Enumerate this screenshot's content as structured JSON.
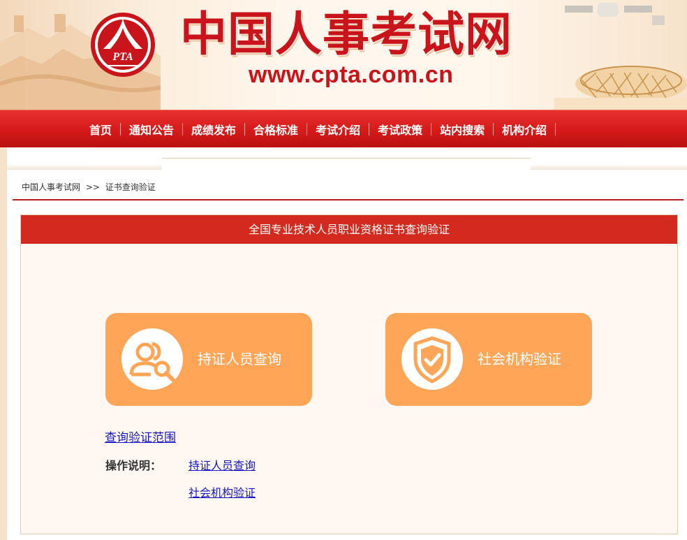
{
  "header": {
    "site_title": "中国人事考试网",
    "site_url": "www.cpta.com.cn",
    "logo_text": "PTA"
  },
  "nav": {
    "items": [
      {
        "label": "首页"
      },
      {
        "label": "通知公告"
      },
      {
        "label": "成绩发布"
      },
      {
        "label": "合格标准"
      },
      {
        "label": "考试介绍"
      },
      {
        "label": "考试政策"
      },
      {
        "label": "站内搜索"
      },
      {
        "label": "机构介绍"
      }
    ]
  },
  "breadcrumb": {
    "home": "中国人事考试网",
    "separator": ">>",
    "current": "证书查询验证"
  },
  "panel": {
    "title": "全国专业技术人员职业资格证书查询验证",
    "buttons": [
      {
        "label": "持证人员查询",
        "icon": "person-search-icon"
      },
      {
        "label": "社会机构验证",
        "icon": "shield-check-icon"
      }
    ],
    "scope_link": "查询验证范围",
    "instructions_label": "操作说明：",
    "instruction_links": [
      "持证人员查询",
      "社会机构验证"
    ]
  },
  "colors": {
    "brand_red": "#c8141a",
    "nav_red": "#d41b1a",
    "button_orange": "#fea558",
    "panel_bg": "#fff8f2",
    "link_blue": "#1515c4"
  }
}
